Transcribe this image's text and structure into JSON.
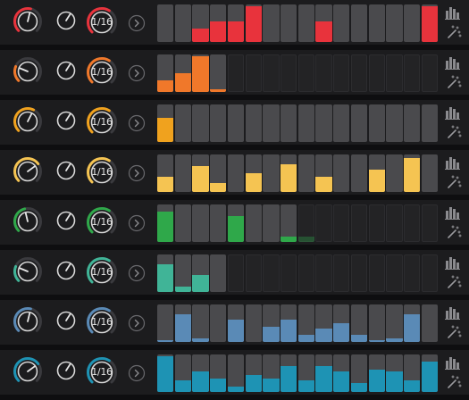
{
  "lanes": [
    {
      "color": "#e8333c",
      "rate": "1/16",
      "knob1_level": 0.55,
      "length": 16,
      "steps": [
        0.0,
        0.0,
        0.35,
        0.55,
        0.55,
        0.95,
        0.0,
        0.0,
        0.0,
        0.55,
        0.0,
        0.0,
        0.0,
        0.0,
        0.0,
        0.95,
        0.0,
        0.0,
        0.0,
        0.0,
        0.0,
        0.0,
        0.0,
        0.0,
        0.0,
        0.0,
        0.0,
        0.0,
        0.0,
        0.0,
        0.0,
        0.0
      ],
      "note": "lane 1 steps are narrower (16 narrow cells)"
    },
    {
      "color": "#f0782a",
      "rate": "1/16",
      "knob1_level": 0.25,
      "length": 4,
      "steps": [
        0.3,
        0.5,
        0.95,
        0.08,
        0,
        0,
        0,
        0,
        0,
        0,
        0,
        0,
        0,
        0,
        0,
        0
      ]
    },
    {
      "color": "#f0a21e",
      "rate": "1/16",
      "knob1_level": 0.6,
      "length": 16,
      "steps": [
        0.65,
        0,
        0,
        0,
        0,
        0,
        0,
        0,
        0,
        0,
        0,
        0,
        0,
        0,
        0,
        0
      ]
    },
    {
      "color": "#f5c452",
      "rate": "1/16",
      "knob1_level": 0.7,
      "length": 16,
      "steps": [
        0.4,
        0,
        0.7,
        0.25,
        0,
        0.5,
        0,
        0.75,
        0,
        0.4,
        0,
        0,
        0.6,
        0,
        0.9,
        0
      ]
    },
    {
      "color": "#2fa84a",
      "rate": "1/16",
      "knob1_level": 0.45,
      "length": 8,
      "steps": [
        0.8,
        0,
        0,
        0,
        0.7,
        0,
        0,
        0.15,
        0.15,
        0,
        0,
        0,
        0,
        0,
        0,
        0
      ]
    },
    {
      "color": "#40b497",
      "rate": "1/16",
      "knob1_level": 0.25,
      "length": 4,
      "steps": [
        0.75,
        0.15,
        0.45,
        0,
        0,
        0,
        0,
        0,
        0,
        0,
        0,
        0,
        0,
        0,
        0,
        0
      ]
    },
    {
      "color": "#5a8ab6",
      "rate": "1/16",
      "knob1_level": 0.55,
      "length": 16,
      "steps": [
        0.05,
        0.75,
        0.1,
        0,
        0.6,
        0,
        0.4,
        0.6,
        0.2,
        0.35,
        0.5,
        0.2,
        0.05,
        0.1,
        0.75,
        0
      ]
    },
    {
      "color": "#1e93b4",
      "rate": "1/16",
      "knob1_level": 0.7,
      "length": 16,
      "steps": [
        0.95,
        0.3,
        0.55,
        0.35,
        0.15,
        0.45,
        0.35,
        0.7,
        0.3,
        0.7,
        0.55,
        0.25,
        0.6,
        0.55,
        0.3,
        0.8
      ]
    }
  ],
  "icons": {
    "expand": "chevron-right-icon",
    "bars": "velocity-bars-icon",
    "magic": "magic-wand-icon"
  }
}
